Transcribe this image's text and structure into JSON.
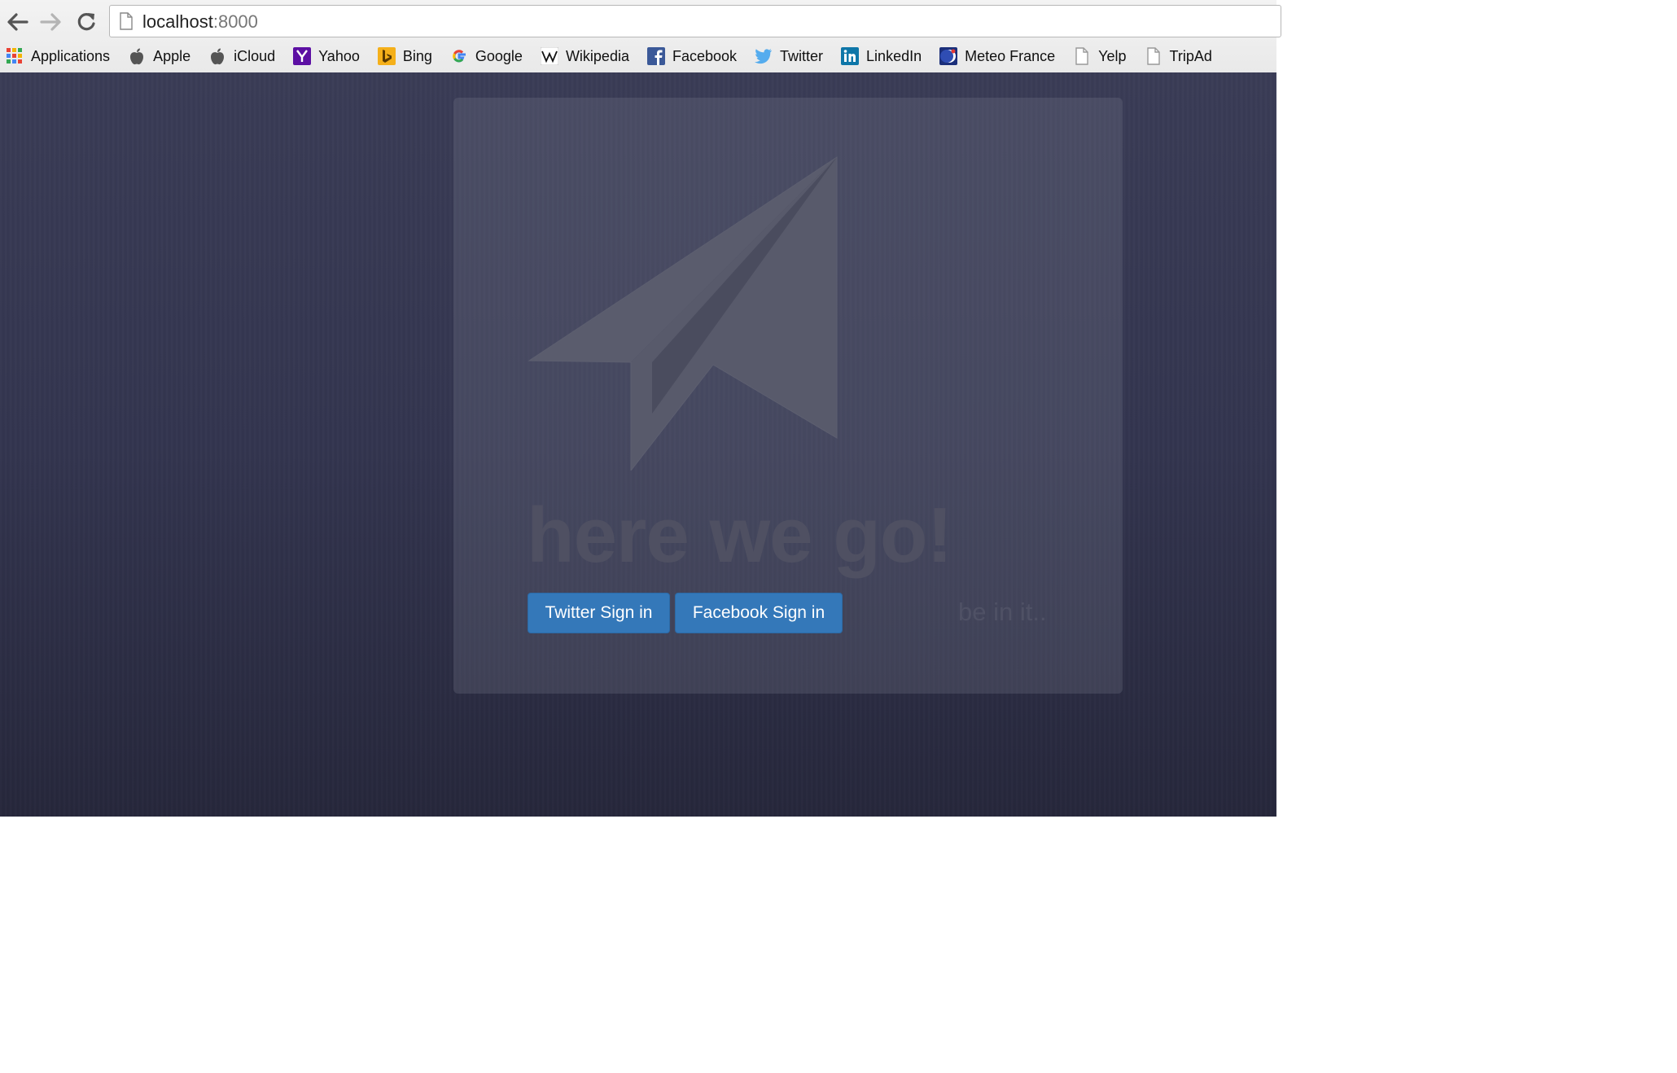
{
  "browser": {
    "url_host": "localhost",
    "url_port": ":8000",
    "bookmarks": [
      {
        "label": "Applications",
        "icon": "apps-grid-icon"
      },
      {
        "label": "Apple",
        "icon": "apple-icon"
      },
      {
        "label": "iCloud",
        "icon": "apple-icon"
      },
      {
        "label": "Yahoo",
        "icon": "yahoo-icon"
      },
      {
        "label": "Bing",
        "icon": "bing-icon"
      },
      {
        "label": "Google",
        "icon": "google-icon"
      },
      {
        "label": "Wikipedia",
        "icon": "wikipedia-icon"
      },
      {
        "label": "Facebook",
        "icon": "facebook-icon"
      },
      {
        "label": "Twitter",
        "icon": "twitter-icon"
      },
      {
        "label": "LinkedIn",
        "icon": "linkedin-icon"
      },
      {
        "label": "Meteo France",
        "icon": "meteo-france-icon"
      },
      {
        "label": "Yelp",
        "icon": "page-icon"
      },
      {
        "label": "TripAd",
        "icon": "page-icon"
      }
    ]
  },
  "main": {
    "headline": "here we go!",
    "twitter_button": "Twitter Sign in",
    "facebook_button": "Facebook Sign in",
    "tagline": "be in it.."
  },
  "colors": {
    "button_blue": "#3478b9",
    "page_background": "#33354f"
  }
}
